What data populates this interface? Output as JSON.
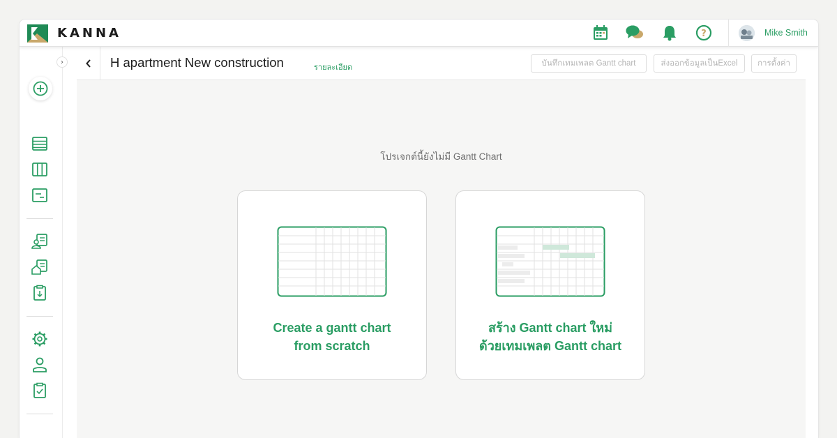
{
  "app": {
    "brand": "KANNA",
    "colors": {
      "accent": "#2a9d63",
      "logo_dark": "#1f8a55",
      "logo_gold": "#c9a86b"
    }
  },
  "topbar": {
    "icons": [
      "calendar-icon",
      "chat-icon",
      "bell-icon",
      "help-icon"
    ],
    "user_name": "Mike Smith"
  },
  "sidebar": {
    "icons": [
      "add-circle-icon",
      "list-icon",
      "board-icon",
      "form-icon",
      "customer-icon",
      "property-icon",
      "download-clipboard-icon",
      "settings-icon",
      "user-icon",
      "checklist-icon"
    ]
  },
  "header": {
    "title": "H apartment New construction",
    "details_link": "รายละเอียด",
    "buttons": {
      "save_template": "บันทึกเทมเพลต Gantt chart",
      "export_excel": "ส่งออกข้อมูลเป็นExcel",
      "settings": "การตั้งค่า"
    }
  },
  "main": {
    "empty_message": "โปรเจกต์นี้ยังไม่มี Gantt Chart",
    "cards": [
      {
        "label": "Create a gantt chart from scratch",
        "icon": "blank-grid-icon"
      },
      {
        "label": "สร้าง Gantt chart ใหม่ด้วยเทมเพลต Gantt chart",
        "icon": "template-grid-icon"
      }
    ]
  }
}
